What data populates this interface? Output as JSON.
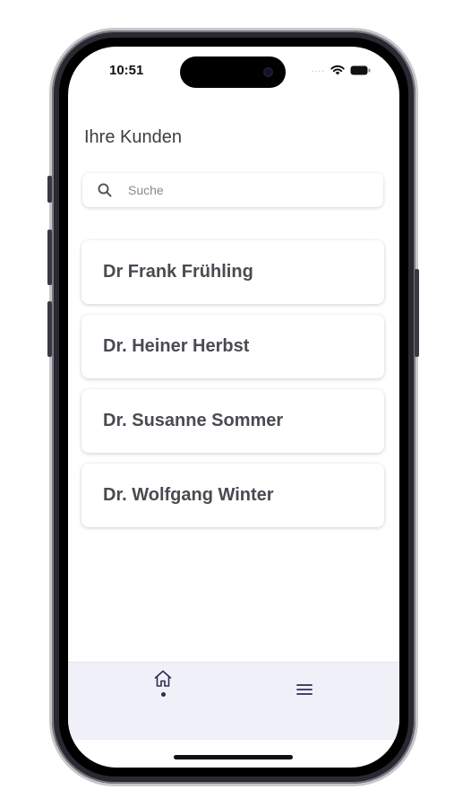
{
  "status_bar": {
    "time": "10:51",
    "signal": "...."
  },
  "header": {
    "title": "Ihre Kunden"
  },
  "search": {
    "placeholder": "Suche"
  },
  "customers": [
    {
      "name": "Dr Frank Frühling"
    },
    {
      "name": "Dr. Heiner Herbst"
    },
    {
      "name": "Dr. Susanne Sommer"
    },
    {
      "name": "Dr. Wolfgang Winter"
    }
  ],
  "tab_bar": {
    "tabs": [
      {
        "icon": "home-icon",
        "active": true
      },
      {
        "icon": "menu-icon",
        "active": false
      }
    ]
  },
  "colors": {
    "tab_bar_bg": "#eff0f8",
    "text_dark": "#4a4a52",
    "icon_navy": "#2b2d52"
  }
}
